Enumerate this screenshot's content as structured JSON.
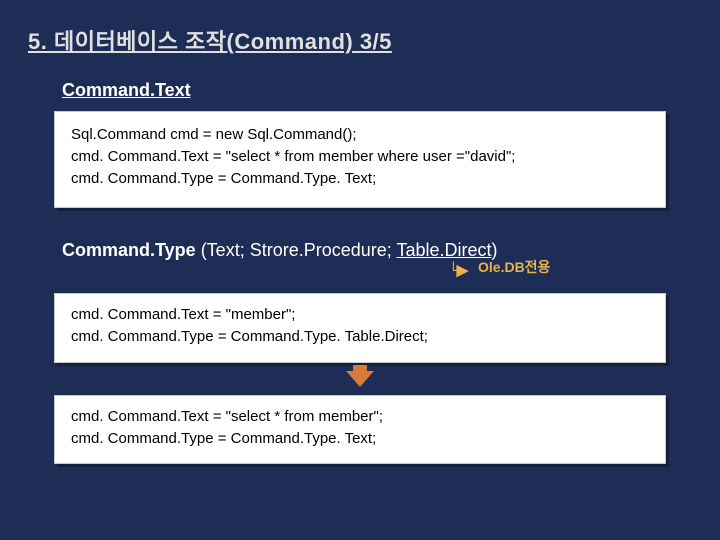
{
  "title": "5. 데이터베이스 조작(Command) 3/5",
  "section1": {
    "heading": "Command.Text",
    "code": [
      "Sql.Command cmd = new Sql.Command();",
      "cmd. Command.Text = \"select * from member where user =\"david\";",
      "cmd. Command.Type = Command.Type. Text;"
    ]
  },
  "section2": {
    "lead": "Command.Type",
    "sub_prefix": " (Text; Strore.Procedure; ",
    "sub_underlined": "Table.Direct",
    "sub_suffix": ")",
    "annotation_arrow": "└▶",
    "annotation_text": "Ole.DB전용"
  },
  "box2": {
    "code": [
      "cmd. Command.Text = \"member\";",
      "cmd. Command.Type = Command.Type. Table.Direct;"
    ]
  },
  "box3": {
    "code": [
      "cmd. Command.Text = \"select * from member\";",
      "cmd. Command.Type = Command.Type. Text;"
    ]
  }
}
